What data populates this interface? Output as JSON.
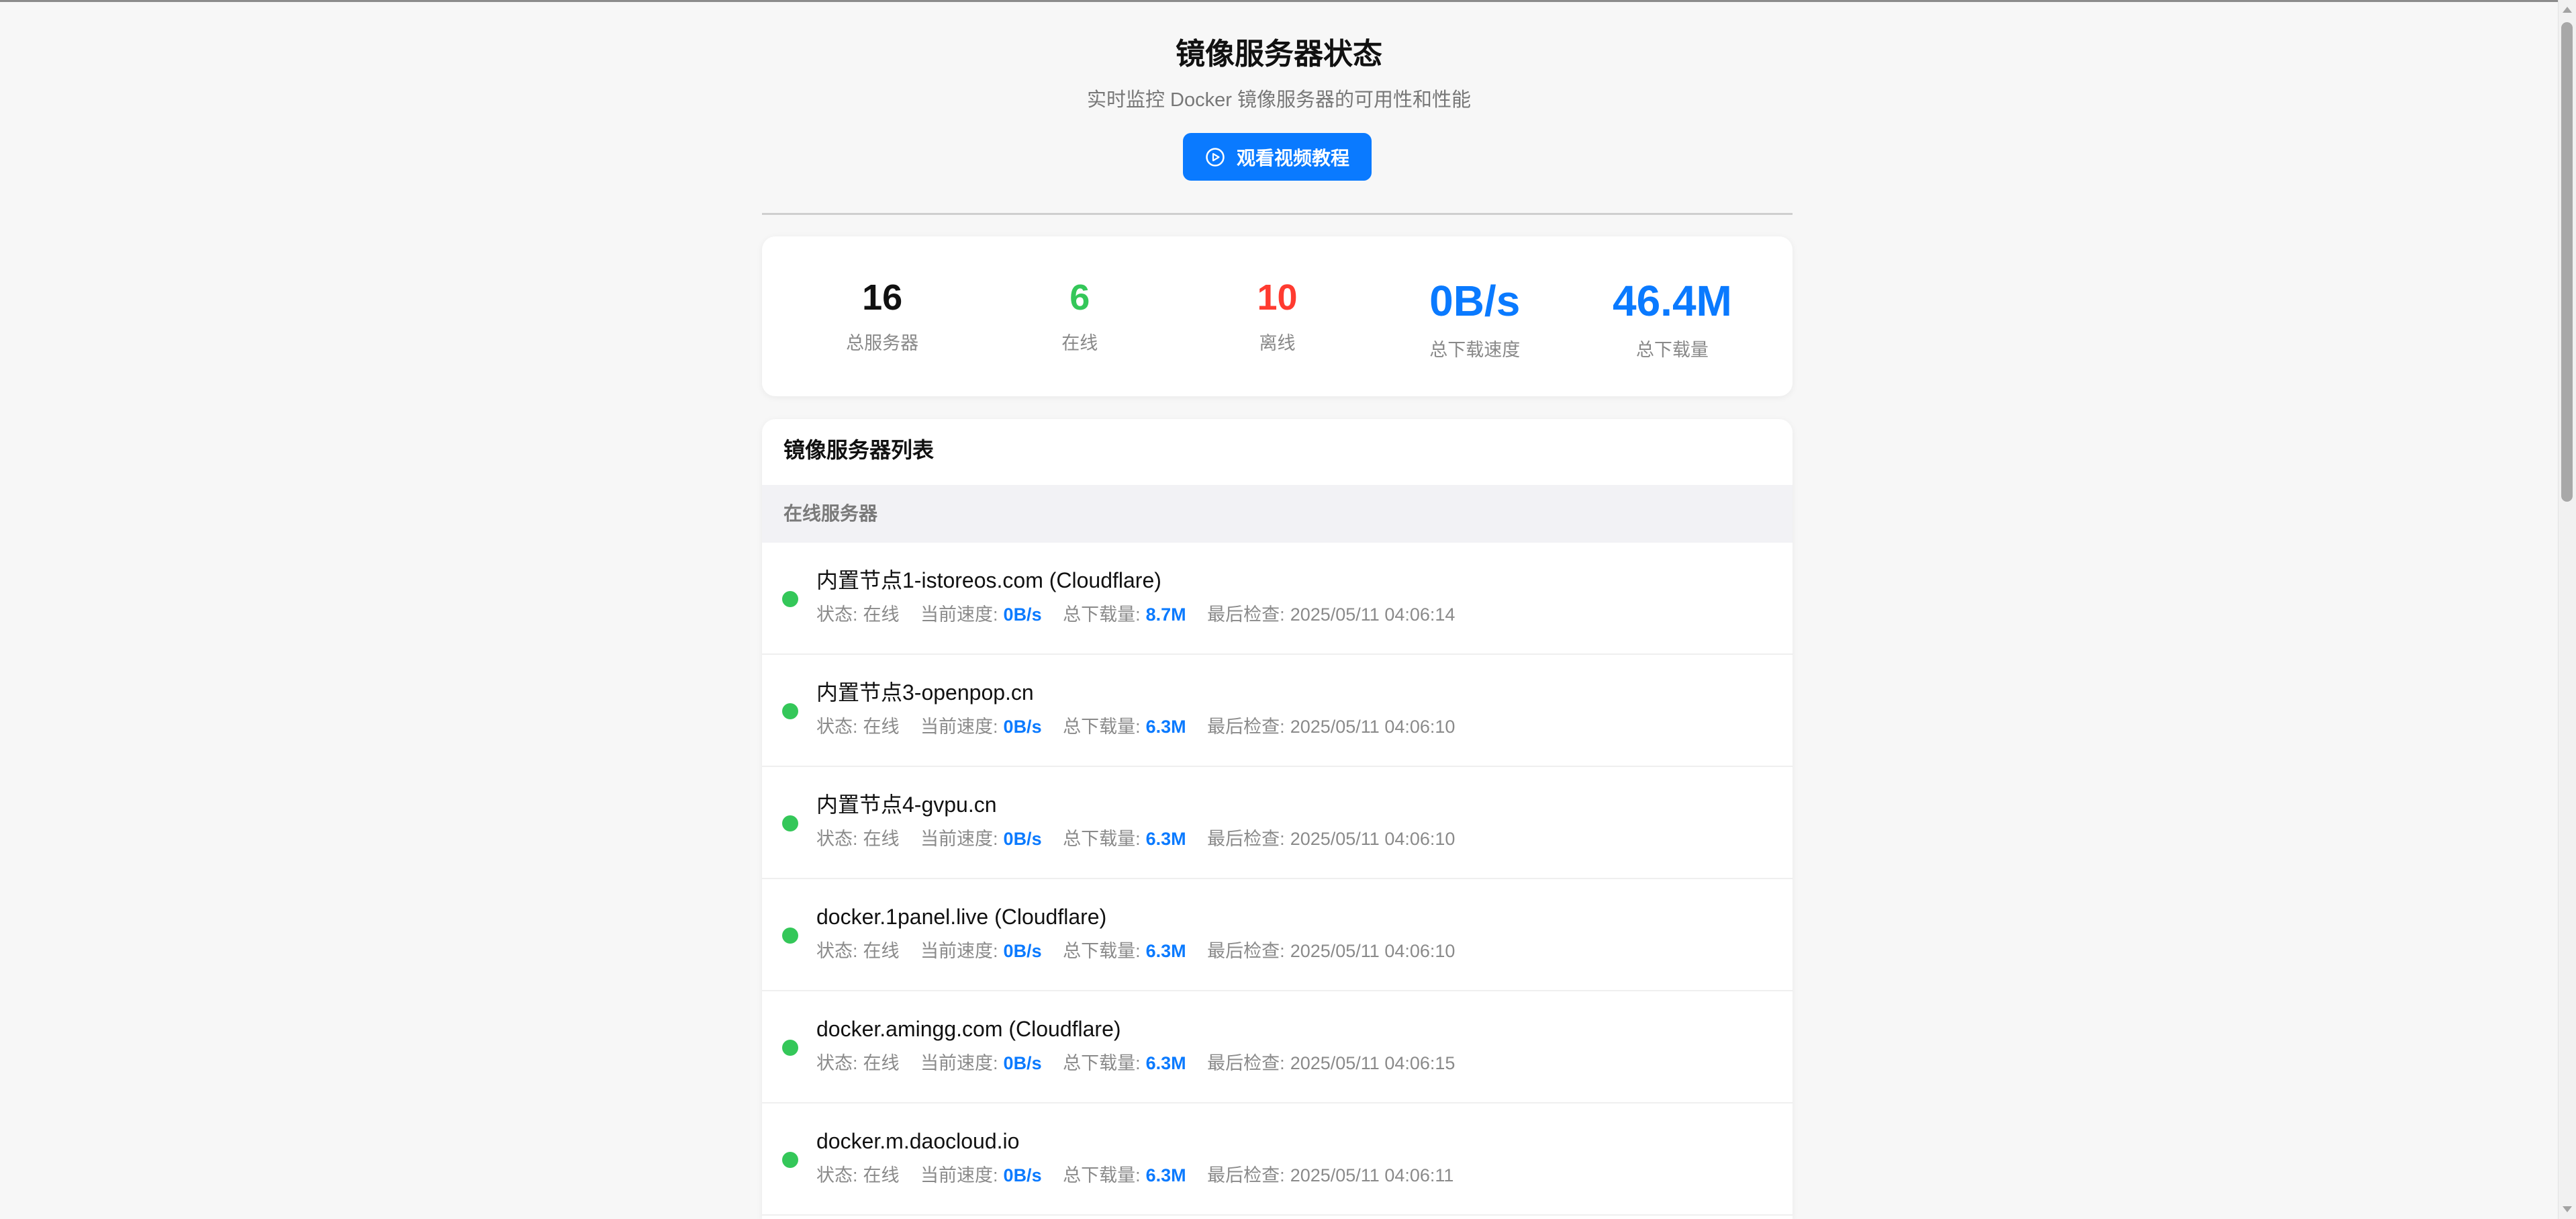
{
  "theme": {
    "accent": "#0a7aff",
    "online": "#34c759",
    "offline": "#ff3b30",
    "text": "#111111"
  },
  "page": {
    "title": "镜像服务器状态",
    "subtitle": "实时监控 Docker 镜像服务器的可用性和性能",
    "tutorial_button": {
      "label": "观看视频教程",
      "icon": "play-circle-icon"
    }
  },
  "stats": [
    {
      "value": "16",
      "label": "总服务器",
      "color": "#111111"
    },
    {
      "value": "6",
      "label": "在线",
      "color": "#34c759"
    },
    {
      "value": "10",
      "label": "离线",
      "color": "#ff3b30"
    },
    {
      "value": "0B/s",
      "label": "总下载速度",
      "color": "#0a7aff"
    },
    {
      "value": "46.4M",
      "label": "总下载量",
      "color": "#0a7aff"
    }
  ],
  "server_list": {
    "title": "镜像服务器列表",
    "field_labels": {
      "status": "状态:",
      "speed": "当前速度:",
      "total": "总下载量:",
      "last_check": "最后检查:"
    },
    "groups": [
      {
        "label": "在线服务器",
        "servers": [
          {
            "name": "内置节点1-istoreos.com (Cloudflare)",
            "status": "在线",
            "speed": "0B/s",
            "total": "8.7M",
            "last_check": "2025/05/11 04:06:14"
          },
          {
            "name": "内置节点3-openpop.cn",
            "status": "在线",
            "speed": "0B/s",
            "total": "6.3M",
            "last_check": "2025/05/11 04:06:10"
          },
          {
            "name": "内置节点4-gvpu.cn",
            "status": "在线",
            "speed": "0B/s",
            "total": "6.3M",
            "last_check": "2025/05/11 04:06:10"
          },
          {
            "name": "docker.1panel.live (Cloudflare)",
            "status": "在线",
            "speed": "0B/s",
            "total": "6.3M",
            "last_check": "2025/05/11 04:06:10"
          },
          {
            "name": "docker.amingg.com (Cloudflare)",
            "status": "在线",
            "speed": "0B/s",
            "total": "6.3M",
            "last_check": "2025/05/11 04:06:15"
          },
          {
            "name": "docker.m.daocloud.io",
            "status": "在线",
            "speed": "0B/s",
            "total": "6.3M",
            "last_check": "2025/05/11 04:06:11"
          }
        ]
      }
    ]
  }
}
